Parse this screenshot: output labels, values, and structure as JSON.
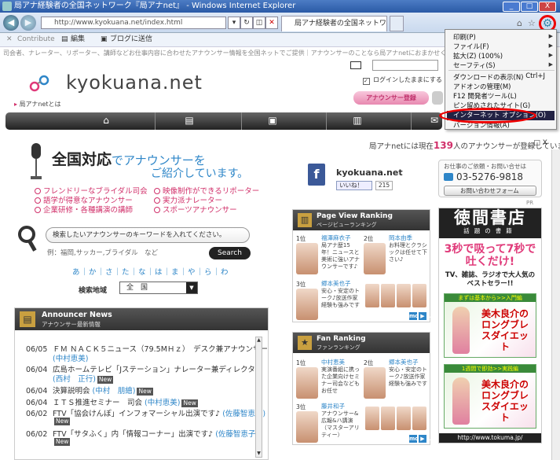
{
  "window": {
    "title": "局アナ経験者の全国ネットワーク『局アナnet』 - Windows Internet Explorer",
    "minimize": "_",
    "maximize": "□",
    "close": "X"
  },
  "address": {
    "url": "http://www.kyokuana.net/index.html",
    "tab_title": "局アナ経験者の全国ネットワ..."
  },
  "favorites": {
    "contribute": "Contribute",
    "edit": "編集",
    "blog": "ブログに送信"
  },
  "site": {
    "marquee": "司会者、ナレーター、リポーター、講師などお仕事内容に合わせたアナウンサー情報を全国ネットでご提供｜アナウンサーのことなら局アナnetにおまかせください",
    "logo": "kyokuana.net",
    "about": "局アナnetとは",
    "remember": "ログインしたままにする",
    "register": "アナウンサー登録",
    "hero_main": "全国対応",
    "hero_de": "でアナウンサーを",
    "hero_sub": "ご紹介しています。",
    "categories": [
      "フレンドリーなブライダル司会",
      "映像制作ができるリポーター",
      "語学が得意なアナウンサー",
      "実力派ナレーター",
      "企業研修・各種講演の講師",
      "スポーツアナウンサー"
    ],
    "search_placeholder": "検索したいアナウンサーのキーワードを入れてください。",
    "example": "例：福岡,サッカー,ブライダル　など",
    "search_button": "Search",
    "kana": "あ｜か｜さ｜た｜な｜は｜ま｜や｜ら｜わ",
    "region_label": "検索地域",
    "region_value": "全　国",
    "tally_pre": "局アナnetには現在",
    "tally_num": "139",
    "tally_post": "人のアナウンサーが登録しています。",
    "fb_name": "kyokuana.net",
    "fb_like": "いいね！",
    "fb_count": "215",
    "contact_q": "お仕事のご依頼・お問い合せは",
    "contact_phone": "03-5276-9818",
    "contact_form": "お問い合わせフォーム",
    "pr": "PR"
  },
  "news": {
    "title": "Announcer News",
    "subtitle": "アナウンサー最新情報",
    "items": [
      {
        "date": "06/05",
        "text": "ＦＭ ＮＡＣＫ５ニュース（79.5MＨｚ）　デスク兼アナウンサー",
        "link": "(中村恵美)",
        "new": ""
      },
      {
        "date": "06/04",
        "text": "広島ホームテレビ「Jステーション」ナレーター兼ディレクター",
        "link": "(西村　正行)",
        "new": "New"
      },
      {
        "date": "06/04",
        "text": "決算説明会",
        "link": "(中村　朋繪)",
        "new": "New"
      },
      {
        "date": "06/04",
        "text": "ＩＴＳ推進セミナー　司会",
        "link": "(中村恵美)",
        "new": "New"
      },
      {
        "date": "06/02",
        "text": "FTV「協会けんぽ」インフォマーシャル出演です♪",
        "link": "(佐藤智恵子)",
        "new": "New"
      },
      {
        "date": "06/02",
        "text": "FTV「サタふく」内「情報コーナー」出演です♪",
        "link": "(佐藤智恵子)",
        "new": "New"
      }
    ]
  },
  "pv_ranking": {
    "title": "Page View Ranking",
    "subtitle": "ページビューランキング",
    "items": [
      {
        "rank": "1位",
        "name": "福澤麻衣子",
        "desc": "局アナ歴15年！ニュースと美術に強いアナウンサーです♪"
      },
      {
        "rank": "2位",
        "name": "岡本由季",
        "desc": "お料理とクラシックは任せて下さい♪"
      },
      {
        "rank": "3位",
        "name": "郷本美也子",
        "desc": "安心・安定のトーク♪放送作家経験も強みです"
      }
    ],
    "more": "more..."
  },
  "fan_ranking": {
    "title": "Fan Ranking",
    "subtitle": "ファンランキング",
    "items": [
      {
        "rank": "1位",
        "name": "中村恵美",
        "desc": "実演番組に携った企業向けセミナー司会などもお任せ"
      },
      {
        "rank": "2位",
        "name": "郷本美也子",
        "desc": "安心・安定のトーク♪放送作家経験も強みです"
      },
      {
        "rank": "3位",
        "name": "藤井和子",
        "desc": "アナウンサー&広報&ハ講演（マスターアリティー）"
      }
    ],
    "more": "more..."
  },
  "ad": {
    "brand": "徳間書店",
    "tagline": "話題の書籍",
    "main": "3秒で吸って7秒で吐くだけ!",
    "sub": "TV、雑誌、ラジオで大人気のベストセラー!!",
    "book1_label": "まずは基本から>>入門編",
    "book1_title": "美木良介のロングブレスダイエット",
    "book2_label": "1週間で即効>>実践編",
    "book2_title": "美木良介のロングブレスダイエット",
    "url": "http://www.tokuma.jp/"
  },
  "menu": {
    "items": [
      {
        "label": "印刷(P)",
        "key": "",
        "arrow": "▶"
      },
      {
        "label": "ファイル(F)",
        "key": "",
        "arrow": "▶"
      },
      {
        "label": "拡大(Z) (100%)",
        "key": "",
        "arrow": "▶"
      },
      {
        "label": "セーフティ(S)",
        "key": "",
        "arrow": "▶"
      },
      {
        "label": "ダウンロードの表示(N)",
        "key": "Ctrl+J",
        "arrow": ""
      },
      {
        "label": "アドオンの管理(M)",
        "key": "",
        "arrow": ""
      },
      {
        "label": "F12 開発者ツール(L)",
        "key": "",
        "arrow": ""
      },
      {
        "label": "ピン留めされたサイト(G)",
        "key": "",
        "arrow": ""
      },
      {
        "label": "インターネット オプション(O)",
        "key": "",
        "arrow": ""
      },
      {
        "label": "バージョン情報(A)",
        "key": "",
        "arrow": ""
      }
    ]
  },
  "colors": {
    "accent": "#2e86c8",
    "pink": "#d1306a"
  }
}
